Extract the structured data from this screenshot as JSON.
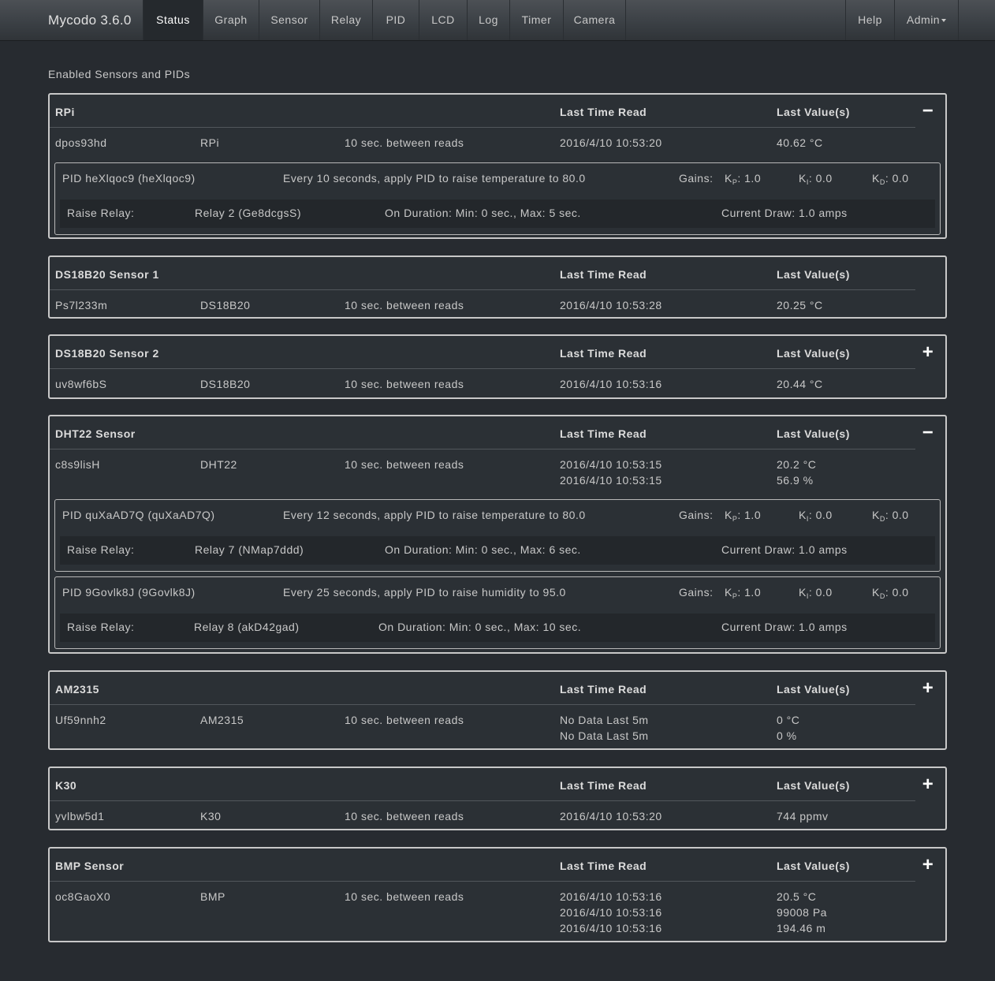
{
  "nav": {
    "brand": "Mycodo 3.6.0",
    "items": [
      {
        "label": "Status"
      },
      {
        "label": "Graph"
      },
      {
        "label": "Sensor"
      },
      {
        "label": "Relay"
      },
      {
        "label": "PID"
      },
      {
        "label": "LCD"
      },
      {
        "label": "Log"
      },
      {
        "label": "Timer"
      },
      {
        "label": "Camera"
      }
    ],
    "help": "Help",
    "admin": "Admin"
  },
  "page_title": "Enabled Sensors and PIDs",
  "columns": {
    "time": "Last Time Read",
    "value": "Last Value(s)"
  },
  "pid_common": {
    "gains_label": "Gains:",
    "kp_label": "K",
    "kp_sub": "P",
    "ki_label": "K",
    "ki_sub": "I",
    "kd_label": "K",
    "kd_sub": "D",
    "raise_relay_label": "Raise Relay:"
  },
  "sensors": [
    {
      "name": "RPi",
      "id": "dpos93hd",
      "device": "RPi",
      "period": "10 sec. between reads",
      "times": [
        "2016/4/10 10:53:20"
      ],
      "values": [
        "40.62 °C"
      ],
      "toggle": "−",
      "pids": [
        {
          "title": "PID heXlqoc9 (heXlqoc9)",
          "desc": "Every 10 seconds, apply PID to raise temperature to 80.0",
          "kp": ": 1.0",
          "ki": ": 0.0",
          "kd": ": 0.0",
          "relay": "Relay 2 (Ge8dcgsS)",
          "duration": "On Duration: Min: 0 sec., Max: 5 sec.",
          "draw": "Current Draw: 1.0 amps"
        }
      ]
    },
    {
      "name": "DS18B20 Sensor 1",
      "id": "Ps7l233m",
      "device": "DS18B20",
      "period": "10 sec. between reads",
      "times": [
        "2016/4/10 10:53:28"
      ],
      "values": [
        "20.25 °C"
      ],
      "toggle": ""
    },
    {
      "name": "DS18B20 Sensor 2",
      "id": "uv8wf6bS",
      "device": "DS18B20",
      "period": "10 sec. between reads",
      "times": [
        "2016/4/10 10:53:16"
      ],
      "values": [
        "20.44 °C"
      ],
      "toggle": "+"
    },
    {
      "name": "DHT22 Sensor",
      "id": "c8s9lisH",
      "device": "DHT22",
      "period": "10 sec. between reads",
      "times": [
        "2016/4/10 10:53:15",
        "2016/4/10 10:53:15"
      ],
      "values": [
        "20.2 °C",
        "56.9 %"
      ],
      "toggle": "−",
      "pids": [
        {
          "title": "PID quXaAD7Q (quXaAD7Q)",
          "desc": "Every 12 seconds, apply PID to raise temperature to 80.0",
          "kp": ": 1.0",
          "ki": ": 0.0",
          "kd": ": 0.0",
          "relay": "Relay 7 (NMap7ddd)",
          "duration": "On Duration: Min: 0 sec., Max: 6 sec.",
          "draw": "Current Draw: 1.0 amps"
        },
        {
          "title": "PID 9Govlk8J (9Govlk8J)",
          "desc": "Every 25 seconds, apply PID to raise humidity to 95.0",
          "kp": ": 1.0",
          "ki": ": 0.0",
          "kd": ": 0.0",
          "relay": "Relay 8 (akD42gad)",
          "duration": "On Duration: Min: 0 sec., Max: 10 sec.",
          "draw": "Current Draw: 1.0 amps"
        }
      ]
    },
    {
      "name": "AM2315",
      "id": "Uf59nnh2",
      "device": "AM2315",
      "period": "10 sec. between reads",
      "times": [
        "No Data Last 5m",
        "No Data Last 5m"
      ],
      "values": [
        "0 °C",
        "0 %"
      ],
      "toggle": "+"
    },
    {
      "name": "K30",
      "id": "yvlbw5d1",
      "device": "K30",
      "period": "10 sec. between reads",
      "times": [
        "2016/4/10 10:53:20"
      ],
      "values": [
        "744 ppmv"
      ],
      "toggle": "+"
    },
    {
      "name": "BMP Sensor",
      "id": "oc8GaoX0",
      "device": "BMP",
      "period": "10 sec. between reads",
      "times": [
        "2016/4/10 10:53:16",
        "2016/4/10 10:53:16",
        "2016/4/10 10:53:16"
      ],
      "values": [
        "20.5 °C",
        "99008 Pa",
        "194.46 m"
      ],
      "toggle": "+"
    }
  ]
}
